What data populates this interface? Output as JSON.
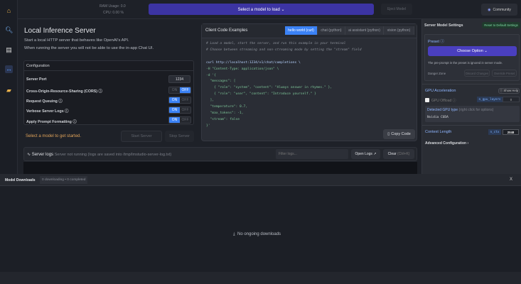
{
  "topbar": {
    "ram_label": "RAM Usage:",
    "ram_value": "0.0",
    "cpu_label": "CPU:",
    "cpu_value": "0.00 %",
    "select_model": "Select a model to load ⌄",
    "eject": "Eject Model",
    "community": "Community"
  },
  "main": {
    "title": "Local Inference Server",
    "subtitle1": "Start a local HTTP server that behaves like OpenAI's API.",
    "subtitle2": "When running the server you will not be able to use the in-app Chat UI.",
    "config": {
      "title": "Configuration",
      "port_label": "Server Port",
      "port_value": "1234",
      "rows": [
        {
          "label": "Cross-Origin-Resource-Sharing (CORS) ⓘ",
          "state": "off"
        },
        {
          "label": "Request Queuing ⓘ",
          "state": "on"
        },
        {
          "label": "Verbose Server Logs ⓘ",
          "state": "on"
        },
        {
          "label": "Apply Prompt Formatting ⓘ",
          "state": "on"
        }
      ],
      "on": "ON",
      "off": "OFF"
    },
    "status": "Select a model to get started.",
    "start": "Start Server",
    "stop": "Stop Server",
    "logs": {
      "title": "Server logs",
      "status": "Server not running (logs are saved into /tmp/lmstudio-server-log.txt)",
      "filter_placeholder": "Filter logs...",
      "open": "Open Logs ↗",
      "clear": "Clear",
      "clear_hint": "(Ctrl+K)"
    }
  },
  "code": {
    "title": "Client Code Examples",
    "tabs": [
      "hello world (curl)",
      "chat (python)",
      "ai assistant (python)",
      "vision (python)"
    ],
    "lines": [
      "# Load a model, start the server, and run this example in your terminal",
      "# Choose between streaming and non-streaming mode by setting the \"stream\" field",
      "",
      "curl http://localhost:1234/v1/chat/completions \\",
      "-H \"Content-Type: application/json\" \\",
      "-d '{",
      "  \"messages\": [",
      "    { \"role\": \"system\", \"content\": \"Always answer in rhymes.\" },",
      "    { \"role\": \"user\", \"content\": \"Introduce yourself.\" }",
      "  ],",
      "  \"temperature\": 0.7,",
      "  \"max_tokens\": -1,",
      "  \"stream\": false",
      "}'"
    ],
    "copy": "Copy Code"
  },
  "right": {
    "title": "Server Model Settings",
    "reset": "Reset to Default Settings",
    "preset": "Preset ⓘ",
    "choose": "Choose Option ⌄",
    "note": "The pre-prompt in the preset is ignored in server mode.",
    "danger": "Danger Zone",
    "discard": "Discard Changes",
    "override": "Override Preset",
    "gpu": "GPU Acceleration",
    "help": "ⓘ Show Help",
    "offload": "GPU Offload ⓘ",
    "ngpu": "n_gpu_layers",
    "ngpu_value": "0",
    "detected": "Detected GPU type",
    "detected_hint": "(right click for options)",
    "gpu_type": "Nvidia CUDA",
    "ctx": "Context Length",
    "nctx": "n_ctx",
    "ctx_value": "2048",
    "advanced": "Advanced Configuration ›"
  },
  "downloads": {
    "title": "Model Downloads",
    "counts": "0 downloading • 0 completed",
    "empty": "No ongoing downloads",
    "close": "X"
  }
}
